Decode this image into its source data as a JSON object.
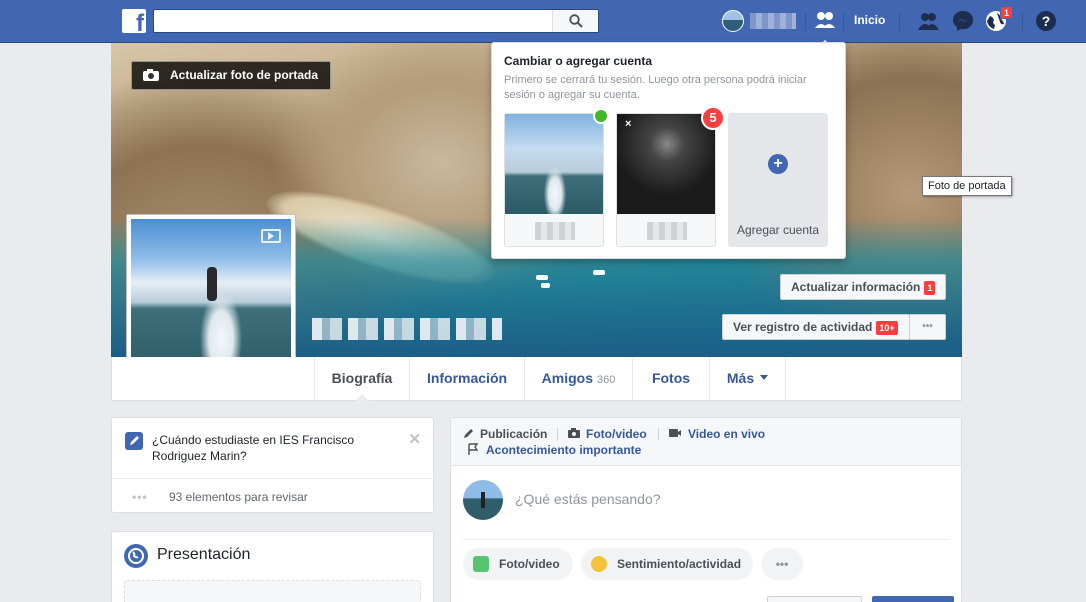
{
  "topbar": {
    "logo": "f",
    "search_placeholder": "",
    "home_label": "Inicio",
    "notifications_badge": "1",
    "icons": [
      "facebook-logo",
      "search-icon",
      "account-switch-icon",
      "friend-requests-icon",
      "messenger-icon",
      "notifications-globe-icon",
      "help-icon"
    ]
  },
  "cover": {
    "update_cover_label": "Actualizar foto de portada",
    "update_info_label": "Actualizar información",
    "update_info_badge": "1",
    "activity_log_label": "Ver registro de actividad",
    "activity_log_badge": "10+",
    "more_label": "•••",
    "tooltip": "Foto de portada"
  },
  "tabs": [
    {
      "label": "Biografía",
      "active": true
    },
    {
      "label": "Información"
    },
    {
      "label": "Amigos",
      "count": "360"
    },
    {
      "label": "Fotos"
    },
    {
      "label": "Más"
    }
  ],
  "dropdown": {
    "title": "Cambiar o agregar cuenta",
    "subtitle": "Primero se cerrará tu sesión. Luego otra persona podrá iniciar sesión o agregar su cuenta.",
    "account2_badge": "5",
    "account2_close": "×",
    "add_account_label": "Agregar cuenta",
    "add_symbol": "+"
  },
  "left": {
    "question": "¿Cuándo estudiaste en IES Francisco Rodriguez Marin?",
    "close": "✕",
    "review_dots": "•••",
    "review_text": "93 elementos para revisar",
    "presentation_title": "Presentación"
  },
  "composer": {
    "tab_publicacion": "Publicación",
    "tab_foto": "Foto/video",
    "tab_live": "Video en vivo",
    "tab_event": "Acontecimiento importante",
    "placeholder": "¿Qué estás pensando?",
    "pill_foto": "Foto/video",
    "pill_feeling": "Sentimiento/actividad",
    "pill_more": "•••"
  },
  "colors": {
    "brand": "#4267b2",
    "link": "#365899",
    "badge": "#fa3e3e",
    "online": "#42b72a"
  }
}
